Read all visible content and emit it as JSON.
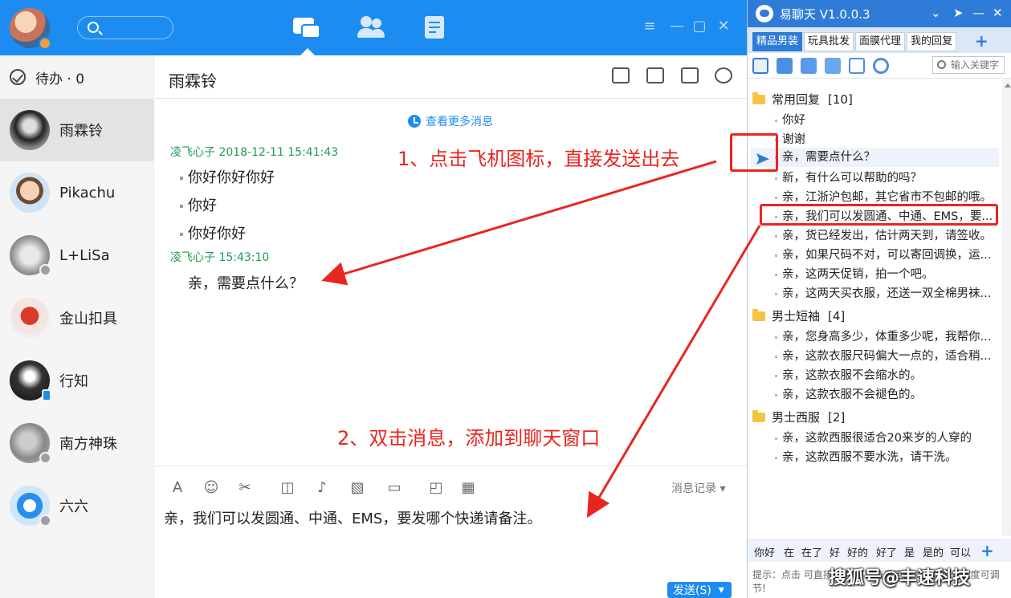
{
  "chat_list": {
    "todo_label": "待办 · 0",
    "contacts": [
      {
        "name": "雨霖铃"
      },
      {
        "name": "Pikachu"
      },
      {
        "name": "L+LiSa"
      },
      {
        "name": "金山扣具"
      },
      {
        "name": "行知"
      },
      {
        "name": "南方神珠"
      },
      {
        "name": "六六"
      }
    ]
  },
  "chat": {
    "title": "雨霖铃",
    "more_messages": "查看更多消息",
    "messages": [
      {
        "sender": "凌飞心子 2018-12-11 15:41:43",
        "lines": [
          "你好你好你好",
          "你好",
          "你好你好"
        ]
      },
      {
        "sender": "凌飞心子  15:43:10",
        "lines": [
          "亲，需要点什么？"
        ]
      }
    ],
    "input_text": "亲，我们可以发圆通、中通、EMS，要发哪个快递请备注。",
    "history_label": "消息记录",
    "send_label": "发送(S)"
  },
  "annotations": {
    "step1": "1、点击飞机图标，直接发送出去",
    "step2": "2、双击消息，添加到聊天窗口"
  },
  "helper": {
    "title": "易聊天 V1.0.0.3",
    "tabs": [
      "精品男装",
      "玩具批发",
      "面膜代理",
      "我的回复"
    ],
    "search_placeholder": "输入关键字",
    "groups": [
      {
        "name": "常用回复",
        "count": "[10]",
        "items": [
          "你好",
          "谢谢",
          "亲，需要点什么？",
          "新，有什么可以帮助的吗？",
          "亲，江浙沪包邮，其它省市不包邮的哦。",
          "亲，我们可以发圆通、中通、EMS，要...",
          "亲，货已经发出，估计两天到，请签收。",
          "亲，如果尺码不对，可以寄回调换，运...",
          "亲，这两天促销，拍一个吧。",
          "亲，这两天买衣服，还送一双全棉男袜..."
        ]
      },
      {
        "name": "男士短袖",
        "count": "[4]",
        "items": [
          "亲，您身高多少，体重多少呢，我帮你...",
          "亲，这款衣服尺码偏大一点的，适合稍...",
          "亲，这款衣服不会缩水的。",
          "亲，这款衣服不会褪色的。"
        ]
      },
      {
        "name": "男士西服",
        "count": "[2]",
        "items": [
          "亲，这款西服很适合20来岁的人穿的",
          "亲，这款西服不要水洗，请干洗。"
        ]
      }
    ],
    "quick_words": [
      "你好",
      "在",
      "在了",
      "好",
      "好的",
      "好了",
      "是",
      "是的",
      "可以"
    ],
    "hint": "提示：点击  可直接发送 右键查看更多功能；窗体宽度可调节!"
  },
  "watermark": "搜狐号@丰速科技",
  "colors": {
    "primary": "#1c8cf0",
    "helper": "#2f7cd8",
    "annotation": "#e8261f",
    "sender": "#1f9a52"
  }
}
